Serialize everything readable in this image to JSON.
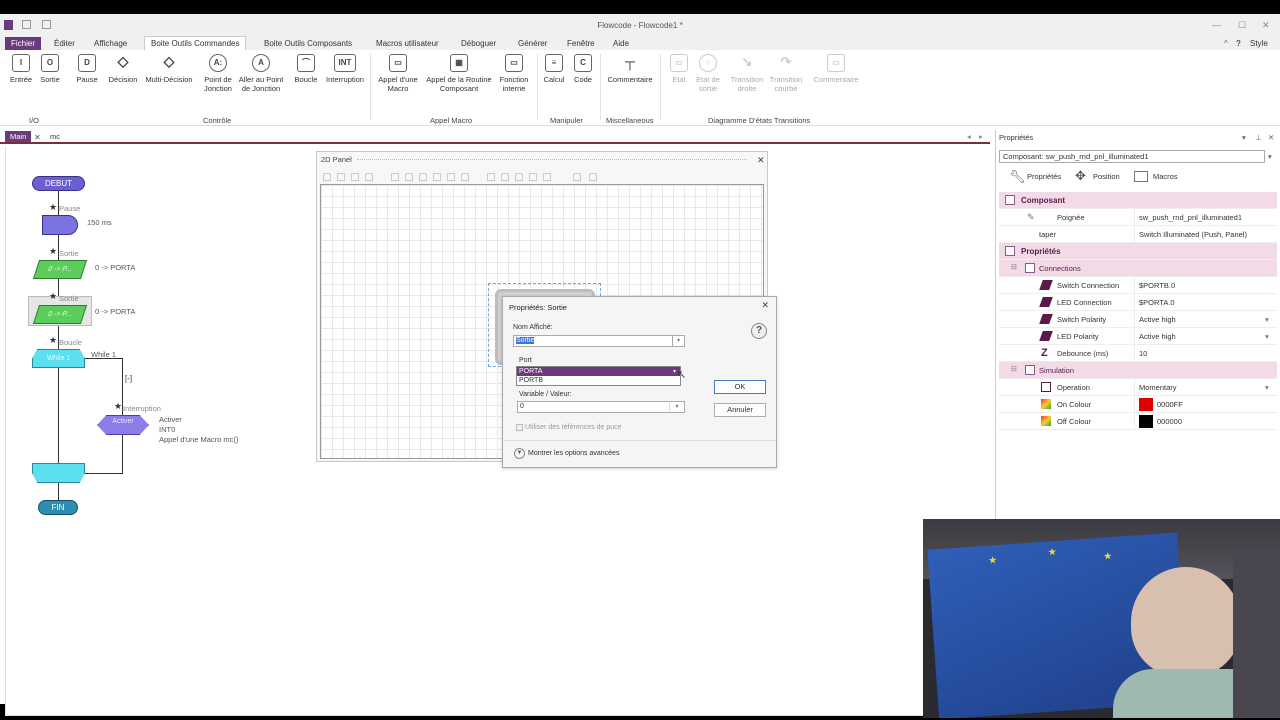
{
  "window": {
    "title": "Flowcode - Flowcode1 *",
    "style_label": "Style"
  },
  "menu": [
    "Fichier",
    "Éditer",
    "Affichage",
    "Boite Outils Commandes",
    "Boite Outils Composants",
    "Macros utilisateur",
    "Déboguer",
    "Générer",
    "Fenêtre",
    "Aide"
  ],
  "ribbon": {
    "buttons": [
      {
        "label": "Entrée",
        "icon": "I"
      },
      {
        "label": "Sortie",
        "icon": "O"
      },
      {
        "label": "Pause",
        "icon": "D"
      },
      {
        "label": "Décision",
        "icon": "◇"
      },
      {
        "label": "Multi-Décision",
        "icon": "◇"
      },
      {
        "label": "Point de Jonction",
        "icon": "A:"
      },
      {
        "label": "Aller au Point de Jonction",
        "icon": "A"
      },
      {
        "label": "Boucle",
        "icon": "⌒"
      },
      {
        "label": "Interruption",
        "icon": "INT"
      },
      {
        "label": "Appel d'une Macro",
        "icon": "▭"
      },
      {
        "label": "Appel de la Routine Composant",
        "icon": "▦"
      },
      {
        "label": "Fonction interne",
        "icon": "▭"
      },
      {
        "label": "Calcul",
        "icon": "≡"
      },
      {
        "label": "Code",
        "icon": "C"
      },
      {
        "label": "Commentaire",
        "icon": "┬"
      },
      {
        "label": "Etat",
        "icon": "▭"
      },
      {
        "label": "Etat de sortie",
        "icon": "○"
      },
      {
        "label": "Transition droite",
        "icon": "↘"
      },
      {
        "label": "Transition courbé",
        "icon": "↷"
      },
      {
        "label": "Commentaire",
        "icon": "▭"
      }
    ],
    "groups": [
      "I/O",
      "Contrôle",
      "Appel Macro",
      "Manipuler",
      "Miscellaneous",
      "Diagramme D'états Transitions"
    ]
  },
  "doc_tabs": [
    "Main",
    "mc"
  ],
  "flowchart": {
    "debut": "DEBUT",
    "fin": "FIN",
    "pause_label": "Pause",
    "pause_value": "150 ms",
    "sortie1_label": "Sortie",
    "sortie1_value": "0 -> PORTA",
    "sortie1_inner": "0 -> P...",
    "sortie2_label": "Sortie",
    "sortie2_value": "0 -> PORTA",
    "sortie2_inner": "0 -> P...",
    "boucle_label": "Boucle",
    "while_value": "While 1",
    "while_inner": "While 1",
    "collapse": "[-]",
    "interrupt_label": "Interruption",
    "interrupt_inner": "Activer",
    "interrupt_lines": [
      "Activer",
      "INT0",
      "Appel d'une Macro mc()"
    ]
  },
  "panel2d": {
    "title": "2D Panel"
  },
  "dialog": {
    "title": "Propriétés: Sortie",
    "name_label": "Nom Affiché:",
    "name_value": "Sortie",
    "port_label": "Port",
    "port_options": [
      "PORTA",
      "PORTB"
    ],
    "var_label": "Variable / Valeur:",
    "var_value": "0",
    "checkbox_label": "Utiliser des références de puce",
    "advanced_label": "Montrer les options avancées",
    "ok": "OK",
    "cancel": "Annuler"
  },
  "properties": {
    "header": "Propriétés",
    "component": "Composant: sw_push_rnd_pnl_illuminated1",
    "tabs": [
      "Propriétés",
      "Position",
      "Macros"
    ],
    "sections": {
      "composant": "Composant",
      "proprietes": "Propriétés",
      "connections": "Connections",
      "simulation": "Simulation"
    },
    "rows": {
      "poignee": {
        "k": "Poignée",
        "v": "sw_push_rnd_pnl_illuminated1"
      },
      "taper": {
        "k": "taper",
        "v": "Switch Illuminated (Push, Panel)"
      },
      "switch_conn": {
        "k": "Switch Connection",
        "v": "$PORTB.0"
      },
      "led_conn": {
        "k": "LED Connection",
        "v": "$PORTA.0"
      },
      "switch_pol": {
        "k": "Switch Polarity",
        "v": "Active high"
      },
      "led_pol": {
        "k": "LED Polarity",
        "v": "Active high"
      },
      "debounce": {
        "k": "Debounce (ms)",
        "v": "10"
      },
      "operation": {
        "k": "Operation",
        "v": "Momentary"
      },
      "on_colour": {
        "k": "On Colour",
        "v": "0000FF"
      },
      "off_colour": {
        "k": "Off Colour",
        "v": "000000"
      }
    },
    "colors": {
      "on_swatch": "#e00000",
      "off_swatch": "#000000"
    }
  },
  "colors": {
    "accent": "#6b3a7d",
    "section_bg": "#f2dbe7"
  }
}
